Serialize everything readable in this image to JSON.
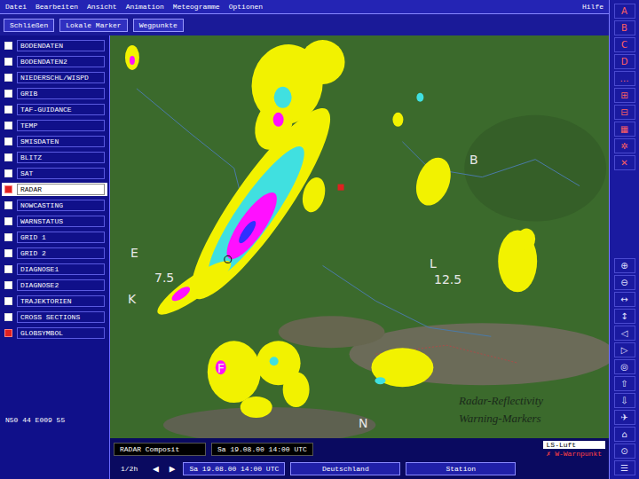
{
  "menu_bar": {
    "items": [
      "Datei",
      "Bearbeiten",
      "Ansicht",
      "Animation",
      "Meteogramme",
      "Optionen"
    ],
    "help": "Hilfe"
  },
  "tool_row": {
    "buttons": [
      "Schließen",
      "Lokale Marker",
      "Wegpunkte"
    ]
  },
  "layers": [
    {
      "label": "BODENDATEN",
      "checked": false,
      "selected": false
    },
    {
      "label": "BODENDATEN2",
      "checked": false,
      "selected": false
    },
    {
      "label": "NIEDERSCHL/WISPD",
      "checked": false,
      "selected": false
    },
    {
      "label": "GRIB",
      "checked": false,
      "selected": false
    },
    {
      "label": "TAF-GUIDANCE",
      "checked": false,
      "selected": false
    },
    {
      "label": "TEMP",
      "checked": false,
      "selected": false
    },
    {
      "label": "SMISDATEN",
      "checked": false,
      "selected": false
    },
    {
      "label": "BLITZ",
      "checked": false,
      "selected": false
    },
    {
      "label": "SAT",
      "checked": false,
      "selected": false
    },
    {
      "label": "RADAR",
      "checked": true,
      "selected": true
    },
    {
      "label": "NOWCASTING",
      "checked": false,
      "selected": false
    },
    {
      "label": "WARNSTATUS",
      "checked": false,
      "selected": false
    },
    {
      "label": "GRID 1",
      "checked": false,
      "selected": false
    },
    {
      "label": "GRID 2",
      "checked": false,
      "selected": false
    },
    {
      "label": "DIAGNOSE1",
      "checked": false,
      "selected": false
    },
    {
      "label": "DIAGNOSE2",
      "checked": false,
      "selected": false
    },
    {
      "label": "TRAJEKTORIEN",
      "checked": false,
      "selected": false
    },
    {
      "label": "CROSS SECTIONS",
      "checked": false,
      "selected": false
    },
    {
      "label": "GLOBSYMBOL",
      "checked": true,
      "selected": false
    }
  ],
  "coordinates": "N50 44 E009 55",
  "map": {
    "labels": [
      "B",
      "E",
      "L",
      "K",
      "F",
      "N",
      "7.5",
      "12.5"
    ],
    "caption": [
      "Radar-Reflectivity",
      "Warning-Markers"
    ]
  },
  "right_tools": {
    "top": [
      "A",
      "B",
      "C",
      "D",
      "…",
      "⊞",
      "⊟",
      "▦",
      "✲",
      "✕"
    ],
    "bottom": [
      "⊕",
      "⊖",
      "↔",
      "↕",
      "◁",
      "▷",
      "◎",
      "⇧",
      "⇩",
      "✈",
      "⌂",
      "⊙",
      "☰"
    ]
  },
  "status_bar": {
    "product": "RADAR Composit",
    "product_time": "Sa 19.08.00 14:00 UTC",
    "legend": [
      "LS-Luft",
      "✗ W-Warnpunkt"
    ],
    "step": "1/2h",
    "prev": "◀",
    "next": "▶",
    "time": "Sa 19.08.00 14:00 UTC",
    "region": "Deutschland",
    "station": "Station"
  }
}
